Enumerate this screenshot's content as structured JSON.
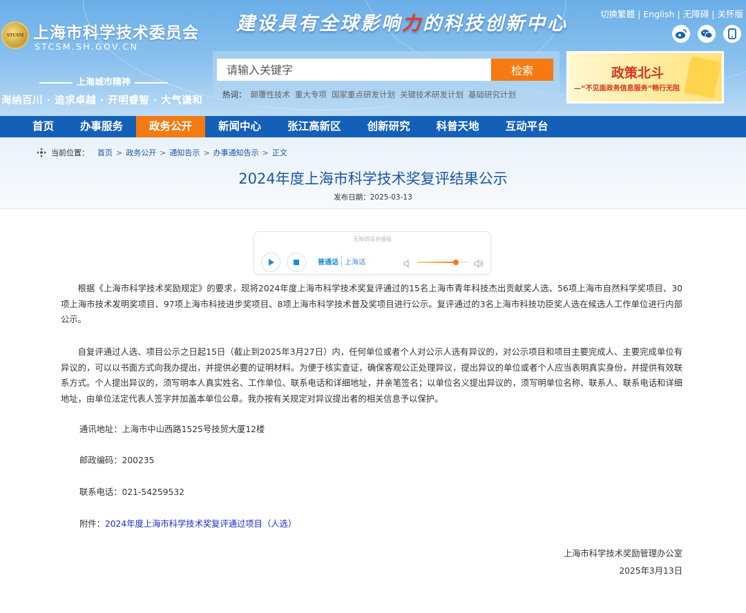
{
  "header": {
    "logo_mark": "STCSM",
    "site_title": "上海市科学技术委员会",
    "site_domain": "STCSM.SH.GOV.CN",
    "slogan_part1": "建设具有全球影响",
    "slogan_highlight": "力",
    "slogan_part2": "的科技创新中心",
    "spirit_title": "上海城市精神",
    "spirit_text": "海纳百川 · 追求卓越 · 开明睿智 · 大气谦和",
    "top_links": [
      "切换繁體",
      "English",
      "无障碍",
      "关怀版"
    ],
    "social_icons": [
      "weibo-icon",
      "wechat-icon",
      "mobile-icon"
    ]
  },
  "search": {
    "placeholder": "请输入关键字",
    "button_label": "检索",
    "hot_label": "热词：",
    "hot_words": [
      "颠覆性技术",
      "重大专项",
      "国家重点研发计划",
      "关键技术研发计划",
      "基础研究计划"
    ]
  },
  "banner": {
    "title": "政策北斗",
    "subtitle": "—“不见面政务信息服务”畅行无阻"
  },
  "nav": {
    "items": [
      "首页",
      "办事服务",
      "政务公开",
      "新闻中心",
      "张江高新区",
      "创新研究",
      "科普天地",
      "互动平台"
    ],
    "active": "政务公开"
  },
  "breadcrumb": {
    "label": "当前位置：",
    "items": [
      "首页",
      "政务公开",
      "通知告示",
      "办事通知告示",
      "正文"
    ]
  },
  "article": {
    "title": "2024年度上海市科学技术奖复评结果公示",
    "publish_date": "发布日期：2025-03-13",
    "para1": "根据《上海市科学技术奖励规定》的要求，现将2024年度上海市科学技术奖复评通过的15名上海市青年科技杰出贡献奖人选、56项上海市自然科学奖项目、30项上海市技术发明奖项目、97项上海市科技进步奖项目、8项上海市科学技术普及奖项目进行公示。复评通过的3名上海市科技功臣奖人选在候选人工作单位进行内部公示。",
    "para2": "自复评通过人选、项目公示之日起15日（截止到2025年3月27日）内，任何单位或者个人对公示人选有异议的，对公示项目和项目主要完成人、主要完成单位有异议的，可以以书面方式向我办提出，并提供必要的证明材料。为便于核实查证，确保客观公正处理异议，提出异议的单位或者个人应当表明真实身份，并提供有效联系方式。个人提出异议的，须写明本人真实姓名、工作单位、联系电话和详细地址，并亲笔签名；以单位名义提出异议的，须写明单位名称、联系人、联系电话和详细地址，由单位法定代表人签字并加盖本单位公章。我办按有关规定对异议提出者的相关信息予以保护。",
    "address_label": "通讯地址：",
    "address": "上海市中山西路1525号技贸大厦12楼",
    "zip_label": "邮政编码：",
    "zip": "200235",
    "phone_label": "联系电话：",
    "phone": "021-54259532",
    "attachment_label": "附件：",
    "attachment_link": "2024年度上海市科学技术奖复评通过项目（人选）",
    "sign_office": "上海市科学技术奖励管理办公室",
    "sign_date": "2025年3月13日"
  },
  "audio": {
    "hint": "无障碍语音播报",
    "lang_active": "普通话",
    "lang_other": "上海话",
    "volume": 0.75
  },
  "colors": {
    "nav_bg": "#1460b8",
    "accent_orange": "#f47a11",
    "title_blue": "#1a55a8",
    "link_blue": "#1a2fc8"
  }
}
